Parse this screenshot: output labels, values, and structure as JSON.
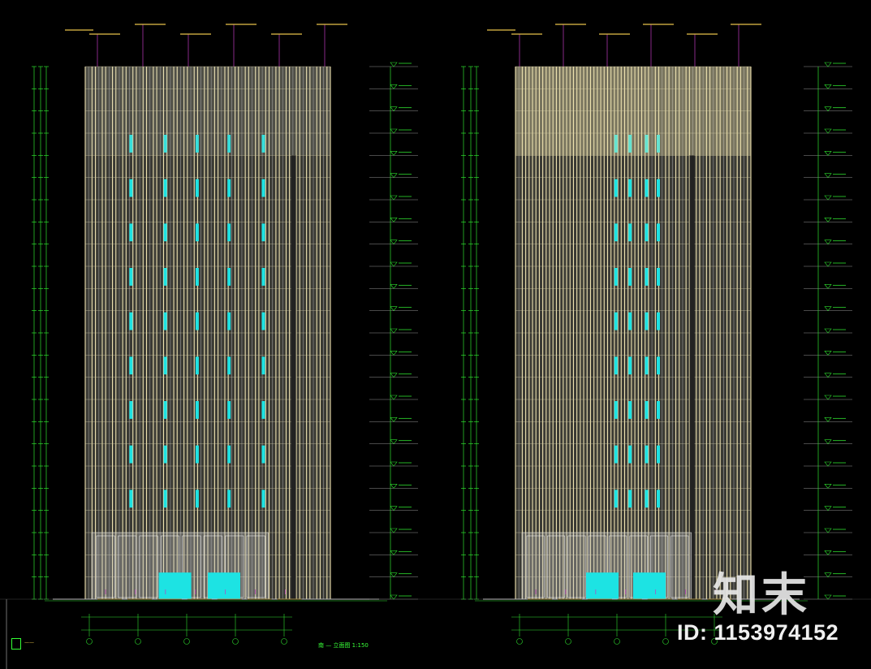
{
  "drawing": {
    "type": "building elevation CAD drawing",
    "colors": {
      "background": "#000000",
      "facade_cream": "#efe3b0",
      "facade_grey": "#8a8a8a",
      "glass_cyan": "#1de3e3",
      "dim_green": "#2ee02e",
      "annotation_yellow": "#e6c14a",
      "leader_magenta": "#c03cc0",
      "white": "#ffffff"
    },
    "floors": 24,
    "left_title": "南 — 立面图 1:150"
  },
  "watermark": {
    "brand": "知末",
    "id_text": "ID: 1153974152",
    "icon": "zhimo-logo-icon"
  }
}
